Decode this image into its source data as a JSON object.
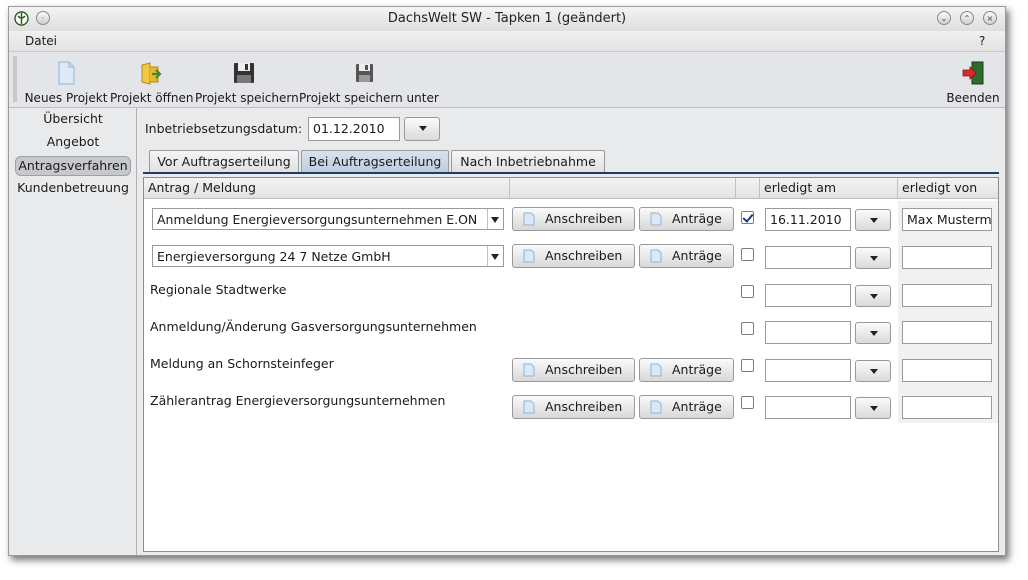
{
  "window": {
    "title": "DachsWelt SW - Tapken 1 (geändert)"
  },
  "menu": {
    "file": "Datei",
    "help": "?"
  },
  "toolbar": {
    "new_project": "Neues Projekt",
    "open_project": "Projekt öffnen",
    "save_project": "Projekt speichern",
    "save_project_as": "Projekt speichern unter",
    "quit": "Beenden"
  },
  "sidebar": {
    "items": [
      {
        "label": "Übersicht"
      },
      {
        "label": "Angebot"
      },
      {
        "label": "Antragsverfahren"
      },
      {
        "label": "Kundenbetreuung"
      }
    ]
  },
  "form": {
    "date_label": "Inbetriebsetzungsdatum:",
    "date_value": "01.12.2010"
  },
  "tabs": [
    {
      "label": "Vor Auftragserteilung"
    },
    {
      "label": "Bei Auftragserteilung"
    },
    {
      "label": "Nach Inbetriebnahme"
    }
  ],
  "table": {
    "headers": {
      "request": "Antrag / Meldung",
      "done_on": "erledigt am",
      "done_by": "erledigt von"
    },
    "btn_letter": "Anschreiben",
    "btn_forms": "Anträge",
    "rows": [
      {
        "label": "Anmeldung Energieversorgungsunternehmen E.ON",
        "checked": true,
        "date": "16.11.2010",
        "by": "Max Musterm"
      },
      {
        "label": "Energieversorgung 24 7 Netze GmbH",
        "checked": false,
        "date": "",
        "by": ""
      },
      {
        "label": "Regionale Stadtwerke",
        "checked": false,
        "date": "",
        "by": ""
      },
      {
        "label": "Anmeldung/Änderung Gasversorgungsunternehmen",
        "checked": false,
        "date": "",
        "by": ""
      },
      {
        "label": "Meldung an Schornsteinfeger",
        "checked": false,
        "date": "",
        "by": ""
      },
      {
        "label": "Zählerantrag Energieversorgungsunternehmen",
        "checked": false,
        "date": "",
        "by": ""
      }
    ]
  }
}
